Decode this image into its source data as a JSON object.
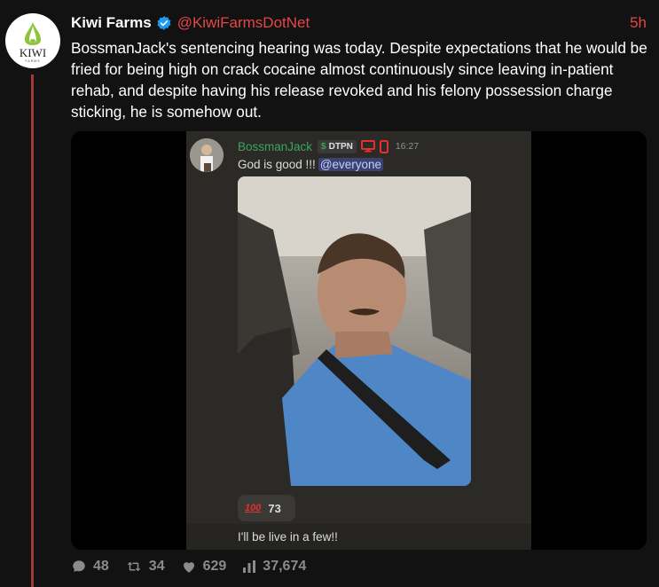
{
  "tweet": {
    "author_name": "Kiwi Farms",
    "handle": "@KiwiFarmsDotNet",
    "time": "5h",
    "text": "BossmanJack's sentencing hearing was today. Despite expectations that he would be fried for being high on crack cocaine almost continuously since leaving in-patient rehab, and despite having his release revoked and his felony possession charge sticking, he is somehow out.",
    "avatar": {
      "logo_text": "KIWI",
      "logo_subtext": "FARMS",
      "icon": "kiwi-logo-icon"
    }
  },
  "discord": {
    "username": "BossmanJack",
    "tag": "DTPN",
    "tag_icon": "dollar-icon",
    "timestamp": "16:27",
    "message": "God is good !!!",
    "mention": "@everyone",
    "reaction": {
      "emoji": "100-emoji",
      "emoji_text": "100",
      "count": "73"
    },
    "followup": "I'll be live in a few!!"
  },
  "stats": {
    "replies": "48",
    "retweets": "34",
    "likes": "629",
    "views": "37,674"
  },
  "colors": {
    "background": "#121212",
    "accent_red": "#e64646",
    "thread_line": "#a33a3a",
    "verified_blue": "#1d9bf0",
    "discord_green": "#3aa55d",
    "discord_bg": "#2b2a26"
  }
}
